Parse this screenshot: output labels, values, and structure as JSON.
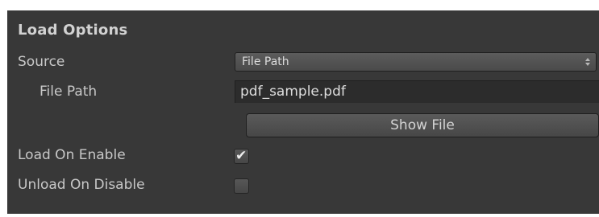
{
  "section": {
    "title": "Load Options"
  },
  "source": {
    "label": "Source",
    "value": "File Path",
    "arrow_icon": "updown-arrow-icon"
  },
  "file_path": {
    "label": "File Path",
    "value": "pdf_sample.pdf"
  },
  "show_file_button": {
    "label": "Show File"
  },
  "load_on_enable": {
    "label": "Load On Enable",
    "checked": true,
    "check_glyph": "✔"
  },
  "unload_on_disable": {
    "label": "Unload On Disable",
    "checked": false
  },
  "colors": {
    "panel_bg": "#383838",
    "text": "#c8c8c8",
    "field_bg": "#2c2c2c"
  }
}
